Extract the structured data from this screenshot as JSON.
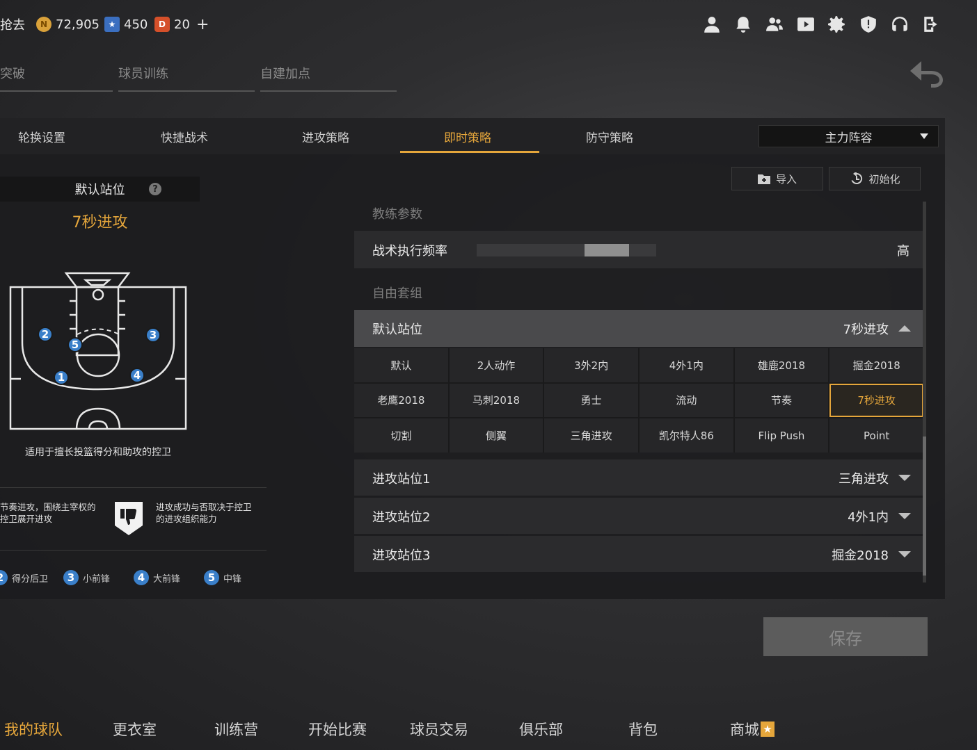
{
  "currency": {
    "cut_label": "抢去",
    "coins": "72,905",
    "stars": "450",
    "tickets": "20",
    "add": "+"
  },
  "subtabs": [
    "突破",
    "球员训练",
    "自建加点"
  ],
  "tabs": [
    "轮换设置",
    "快捷战术",
    "进攻策略",
    "即时策略",
    "防守策略"
  ],
  "lineup": "主力阵容",
  "buttons": {
    "import": "导入",
    "reset": "初始化",
    "save": "保存"
  },
  "left": {
    "header": "默认站位",
    "help": "?",
    "strategy_name": "7秒进攻",
    "court_desc": "适用于擅长投篮得分和助攻的控卫",
    "pros": "节奏进攻，围绕主宰权的控卫展开进攻",
    "cons": "进攻成功与否取决于控卫的进攻组织能力",
    "legend": [
      {
        "num": "2",
        "label": "得分后卫"
      },
      {
        "num": "3",
        "label": "小前锋"
      },
      {
        "num": "4",
        "label": "大前锋"
      },
      {
        "num": "5",
        "label": "中锋"
      }
    ],
    "court_positions": [
      "1",
      "2",
      "3",
      "4",
      "5"
    ]
  },
  "right": {
    "coach_params_label": "教练参数",
    "tactic_freq_label": "战术执行频率",
    "tactic_freq_value": "高",
    "tactic_freq_level": 0.8,
    "free_combo_label": "自由套组",
    "default_pos_label": "默认站位",
    "default_pos_value": "7秒进攻",
    "options": [
      "默认",
      "2人动作",
      "3外2内",
      "4外1内",
      "雄鹿2018",
      "掘金2018",
      "老鹰2018",
      "马刺2018",
      "勇士",
      "流动",
      "节奏",
      "7秒进攻",
      "切割",
      "侧翼",
      "三角进攻",
      "凯尔特人86",
      "Flip Push",
      "Point"
    ],
    "selected_option": "7秒进攻",
    "attack_rows": [
      {
        "label": "进攻站位1",
        "value": "三角进攻"
      },
      {
        "label": "进攻站位2",
        "value": "4外1内"
      },
      {
        "label": "进攻站位3",
        "value": "掘金2018"
      }
    ]
  },
  "nav": [
    "我的球队",
    "更衣室",
    "训练营",
    "开始比赛",
    "球员交易",
    "俱乐部",
    "背包",
    "商城"
  ],
  "colors": {
    "accent": "#e5a63b",
    "badge": "#3a7fc9"
  }
}
